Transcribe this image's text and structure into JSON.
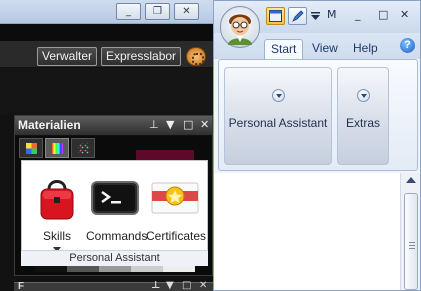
{
  "background_app": {
    "window_controls": [
      "_",
      "❐",
      "✕"
    ],
    "toolbar": {
      "buttons": [
        "Verwalter",
        "Expresslabor"
      ]
    }
  },
  "materials_panel": {
    "title": "Materialien",
    "controls": [
      "⊥",
      "▼",
      "□",
      "✕"
    ],
    "items": [
      {
        "label": "Skills",
        "icon": "red-bag-icon"
      },
      {
        "label": "Commands",
        "icon": "terminal-icon"
      },
      {
        "label": "Certificates",
        "icon": "certificate-icon"
      }
    ],
    "group_label": "Personal Assistant",
    "bottom_panel_initial": "F"
  },
  "ribbon_window": {
    "title_text": "M",
    "window_controls": [
      "_",
      "□",
      "✕"
    ],
    "tabs": [
      "Start",
      "View",
      "Help"
    ],
    "active_tab": "Start",
    "help_glyph": "?",
    "groups": [
      {
        "label": "Personal Assistant"
      },
      {
        "label": "Extras"
      }
    ]
  },
  "colors": {
    "ribbon_accent": "#1e3a66",
    "panel_dark": "#0b0b0b",
    "maroon": "#5d0a2a"
  }
}
